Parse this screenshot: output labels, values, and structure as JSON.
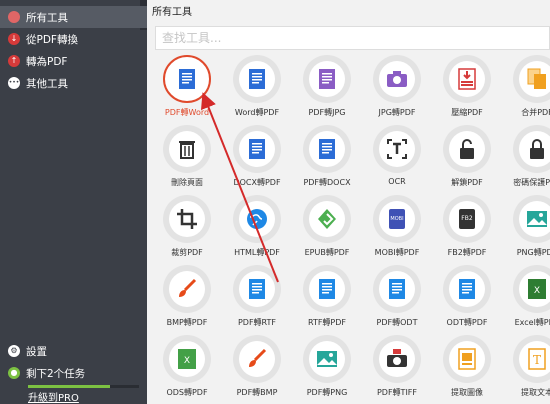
{
  "sidebar": {
    "items": [
      {
        "label": "所有工具",
        "icon": "record-icon",
        "color": "#e06666",
        "active": true
      },
      {
        "label": "從PDF轉換",
        "icon": "download-arrow-icon",
        "color": "#d63a3a",
        "active": false
      },
      {
        "label": "轉為PDF",
        "icon": "upload-arrow-icon",
        "color": "#d63a3a",
        "active": false
      },
      {
        "label": "其他工具",
        "icon": "more-dots-icon",
        "color": "#ffffff",
        "active": false
      }
    ],
    "settings_label": "設置",
    "tasks_label": "剩下2个任务",
    "tasks_progress": 0.74,
    "upgrade_label": "升級到PRO"
  },
  "main": {
    "title": "所有工具",
    "search_placeholder": "查找工具..."
  },
  "tools": [
    {
      "label": "PDF轉Word",
      "icon": "word-doc-icon",
      "color": "#2b6cd6",
      "active": true
    },
    {
      "label": "Word轉PDF",
      "icon": "word-doc-icon",
      "color": "#2b6cd6"
    },
    {
      "label": "PDF轉JPG",
      "icon": "pdf-to-jpg-icon",
      "color": "#8a5cc4"
    },
    {
      "label": "JPG轉PDF",
      "icon": "camera-icon",
      "color": "#8a5cc4"
    },
    {
      "label": "壓縮PDF",
      "icon": "compress-icon",
      "color": "#d63a3a"
    },
    {
      "label": "合并PDF",
      "icon": "merge-icon",
      "color": "#f0a020"
    },
    {
      "label": "刪除頁面",
      "icon": "trash-icon",
      "color": "#333333"
    },
    {
      "label": "DOCX轉PDF",
      "icon": "docx-icon",
      "color": "#2b6cd6"
    },
    {
      "label": "PDF轉DOCX",
      "icon": "docx-icon",
      "color": "#2b6cd6"
    },
    {
      "label": "OCR",
      "icon": "ocr-icon",
      "color": "#333333"
    },
    {
      "label": "解鎖PDF",
      "icon": "unlock-icon",
      "color": "#333333"
    },
    {
      "label": "密碼保護PDF",
      "icon": "lock-icon",
      "color": "#333333"
    },
    {
      "label": "裁剪PDF",
      "icon": "crop-icon",
      "color": "#333333"
    },
    {
      "label": "HTML轉PDF",
      "icon": "globe-icon",
      "color": "#1e88e5"
    },
    {
      "label": "EPUB轉PDF",
      "icon": "epub-icon",
      "color": "#4caf50"
    },
    {
      "label": "MOBI轉PDF",
      "icon": "mobi-icon",
      "color": "#3f51b5"
    },
    {
      "label": "FB2轉PDF",
      "icon": "fb2-icon",
      "color": "#333333"
    },
    {
      "label": "PNG轉PDF",
      "icon": "image-icon",
      "color": "#26a69a"
    },
    {
      "label": "BMP轉PDF",
      "icon": "paintbrush-icon",
      "color": "#e64a19"
    },
    {
      "label": "PDF轉RTF",
      "icon": "rtf-icon",
      "color": "#1e88e5"
    },
    {
      "label": "RTF轉PDF",
      "icon": "rtf-icon",
      "color": "#1e88e5"
    },
    {
      "label": "PDF轉ODT",
      "icon": "odt-icon",
      "color": "#1e88e5"
    },
    {
      "label": "ODT轉PDF",
      "icon": "odt-icon",
      "color": "#1e88e5"
    },
    {
      "label": "Excel轉PDF",
      "icon": "excel-icon",
      "color": "#2e7d32"
    },
    {
      "label": "ODS轉PDF",
      "icon": "ods-icon",
      "color": "#43a047"
    },
    {
      "label": "PDF轉BMP",
      "icon": "paintbrush-icon",
      "color": "#e64a19"
    },
    {
      "label": "PDF轉PNG",
      "icon": "png-icon",
      "color": "#26a69a"
    },
    {
      "label": "PDF轉TIFF",
      "icon": "tiff-camera-icon",
      "color": "#333333"
    },
    {
      "label": "提取圖像",
      "icon": "extract-image-icon",
      "color": "#f0a020"
    },
    {
      "label": "提取文本",
      "icon": "extract-text-icon",
      "color": "#f0a020"
    }
  ]
}
